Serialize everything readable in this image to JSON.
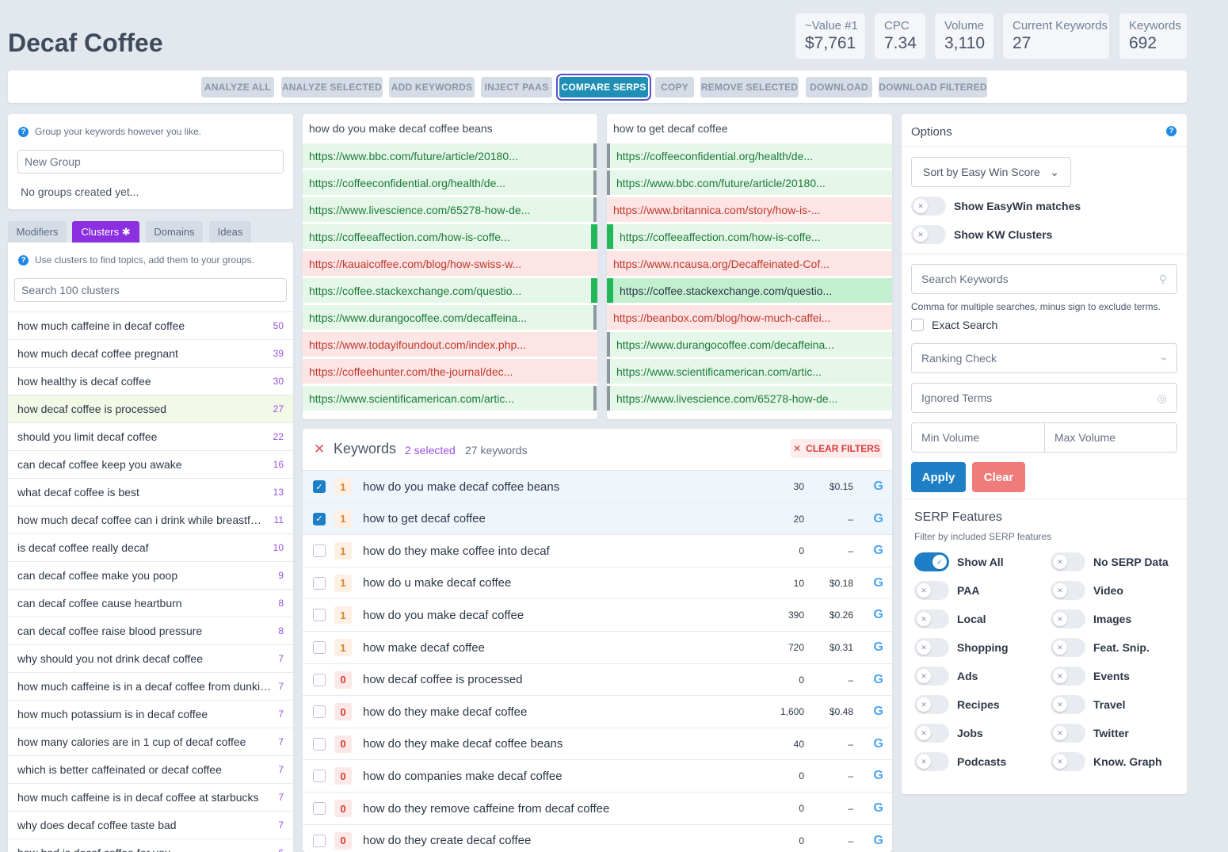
{
  "title": "Decaf Coffee",
  "stats": [
    {
      "label": "~Value #1",
      "value": "$7,761"
    },
    {
      "label": "CPC",
      "value": "7.34"
    },
    {
      "label": "Volume",
      "value": "3,110"
    },
    {
      "label": "Current Keywords",
      "value": "27"
    },
    {
      "label": "Keywords",
      "value": "692"
    }
  ],
  "toolbar": {
    "analyze_all": "ANALYZE ALL",
    "analyze_selected": "ANALYZE SELECTED",
    "add_keywords": "ADD KEYWORDS",
    "inject_paas": "INJECT PAAS",
    "compare_serps": "COMPARE SERPS",
    "copy": "COPY",
    "remove_selected": "REMOVE SELECTED",
    "download": "DOWNLOAD",
    "download_filtered": "DOWNLOAD FILTERED"
  },
  "groups": {
    "hint": "Group your keywords however you like.",
    "input_placeholder": "New Group",
    "empty_text": "No groups created yet..."
  },
  "tabs": {
    "modifiers": "Modifiers",
    "clusters": "Clusters",
    "clusters_badge": "✱",
    "domains": "Domains",
    "ideas": "Ideas"
  },
  "clusters": {
    "hint": "Use clusters to find topics, add them to your groups.",
    "search_placeholder": "Search 100 clusters",
    "items": [
      {
        "label": "how much caffeine in decaf coffee",
        "count": "50"
      },
      {
        "label": "how much decaf coffee pregnant",
        "count": "39"
      },
      {
        "label": "how healthy is decaf coffee",
        "count": "30"
      },
      {
        "label": "how decaf coffee is processed",
        "count": "27"
      },
      {
        "label": "should you limit decaf coffee",
        "count": "22"
      },
      {
        "label": "can decaf coffee keep you awake",
        "count": "16"
      },
      {
        "label": "what decaf coffee is best",
        "count": "13"
      },
      {
        "label": "how much decaf coffee can i drink while breastfeeding",
        "count": "11"
      },
      {
        "label": "is decaf coffee really decaf",
        "count": "10"
      },
      {
        "label": "can decaf coffee make you poop",
        "count": "9"
      },
      {
        "label": "can decaf coffee cause heartburn",
        "count": "8"
      },
      {
        "label": "can decaf coffee raise blood pressure",
        "count": "8"
      },
      {
        "label": "why should you not drink decaf coffee",
        "count": "7"
      },
      {
        "label": "how much caffeine is in a decaf coffee from dunkin donuts",
        "count": "7"
      },
      {
        "label": "how much potassium is in decaf coffee",
        "count": "7"
      },
      {
        "label": "how many calories are in 1 cup of decaf coffee",
        "count": "7"
      },
      {
        "label": "which is better caffeinated or decaf coffee",
        "count": "7"
      },
      {
        "label": "how much caffeine is in decaf coffee at starbucks",
        "count": "7"
      },
      {
        "label": "why does decaf coffee taste bad",
        "count": "7"
      },
      {
        "label": "how bad is decaf coffee for you",
        "count": "6"
      }
    ]
  },
  "serp_left": {
    "query": "how do you make decaf coffee beans",
    "rows": [
      {
        "url": "https://www.bbc.com/future/article/20180...",
        "status": "g",
        "marker": "grey"
      },
      {
        "url": "https://coffeeconfidential.org/health/de...",
        "status": "g",
        "marker": "grey"
      },
      {
        "url": "https://www.livescience.com/65278-how-de...",
        "status": "g",
        "marker": "grey"
      },
      {
        "url": "https://coffeeaffection.com/how-is-coffe...",
        "status": "g",
        "marker": "green"
      },
      {
        "url": "https://kauaicoffee.com/blog/how-swiss-w...",
        "status": "r",
        "marker": "none"
      },
      {
        "url": "https://coffee.stackexchange.com/questio...",
        "status": "g",
        "marker": "green"
      },
      {
        "url": "https://www.durangocoffee.com/decaffeina...",
        "status": "g",
        "marker": "grey"
      },
      {
        "url": "https://www.todayifoundout.com/index.php...",
        "status": "r",
        "marker": "none"
      },
      {
        "url": "https://coffeehunter.com/the-journal/dec...",
        "status": "r",
        "marker": "none"
      },
      {
        "url": "https://www.scientificamerican.com/artic...",
        "status": "g",
        "marker": "grey"
      }
    ]
  },
  "serp_right": {
    "query": "how to get decaf coffee",
    "rows": [
      {
        "url": "https://coffeeconfidential.org/health/de...",
        "status": "g",
        "marker": "grey"
      },
      {
        "url": "https://www.bbc.com/future/article/20180...",
        "status": "g",
        "marker": "grey"
      },
      {
        "url": "https://www.britannica.com/story/how-is-...",
        "status": "r",
        "marker": "none"
      },
      {
        "url": "https://coffeeaffection.com/how-is-coffe...",
        "status": "g",
        "marker": "green"
      },
      {
        "url": "https://www.ncausa.org/Decaffeinated-Cof...",
        "status": "r",
        "marker": "none"
      },
      {
        "url": "https://coffee.stackexchange.com/questio...",
        "status": "bg",
        "marker": "green"
      },
      {
        "url": "https://beanbox.com/blog/how-much-caffei...",
        "status": "r",
        "marker": "none"
      },
      {
        "url": "https://www.durangocoffee.com/decaffeina...",
        "status": "g",
        "marker": "grey"
      },
      {
        "url": "https://www.scientificamerican.com/artic...",
        "status": "g",
        "marker": "grey"
      },
      {
        "url": "https://www.livescience.com/65278-how-de...",
        "status": "g",
        "marker": "grey"
      }
    ]
  },
  "keywords": {
    "title": "Keywords",
    "selected": "2 selected",
    "count": "27 keywords",
    "clear_filters": "CLEAR FILTERS",
    "rows": [
      {
        "checked": true,
        "rank": "1",
        "keyword": "how do you make decaf coffee beans",
        "volume": "30",
        "cpc": "$0.15"
      },
      {
        "checked": true,
        "rank": "1",
        "keyword": "how to get decaf coffee",
        "volume": "20",
        "cpc": "–"
      },
      {
        "checked": false,
        "rank": "1",
        "keyword": "how do they make coffee into decaf",
        "volume": "0",
        "cpc": "–"
      },
      {
        "checked": false,
        "rank": "1",
        "keyword": "how do u make decaf coffee",
        "volume": "10",
        "cpc": "$0.18"
      },
      {
        "checked": false,
        "rank": "1",
        "keyword": "how do you make decaf coffee",
        "volume": "390",
        "cpc": "$0.26"
      },
      {
        "checked": false,
        "rank": "1",
        "keyword": "how make decaf coffee",
        "volume": "720",
        "cpc": "$0.31"
      },
      {
        "checked": false,
        "rank": "0",
        "keyword": "how decaf coffee is processed",
        "volume": "0",
        "cpc": "–"
      },
      {
        "checked": false,
        "rank": "0",
        "keyword": "how do they make decaf coffee",
        "volume": "1,600",
        "cpc": "$0.48"
      },
      {
        "checked": false,
        "rank": "0",
        "keyword": "how do they make decaf coffee beans",
        "volume": "40",
        "cpc": "–"
      },
      {
        "checked": false,
        "rank": "0",
        "keyword": "how do companies make decaf coffee",
        "volume": "0",
        "cpc": "–"
      },
      {
        "checked": false,
        "rank": "0",
        "keyword": "how do they remove caffeine from decaf coffee",
        "volume": "0",
        "cpc": "–"
      },
      {
        "checked": false,
        "rank": "0",
        "keyword": "how do they create decaf coffee",
        "volume": "0",
        "cpc": "–"
      }
    ]
  },
  "options": {
    "title": "Options",
    "sort_label": "Sort by Easy Win Score",
    "show_easywin": "Show EasyWin matches",
    "show_clusters": "Show KW Clusters",
    "search_placeholder": "Search Keywords",
    "search_hint": "Comma for multiple searches, minus sign to exclude terms.",
    "exact_search": "Exact Search",
    "ranking_check_placeholder": "Ranking Check",
    "ignored_terms_placeholder": "Ignored Terms",
    "min_volume_placeholder": "Min Volume",
    "max_volume_placeholder": "Max Volume",
    "apply": "Apply",
    "clear": "Clear",
    "serp_title": "SERP Features",
    "serp_hint": "Filter by included SERP features",
    "features_left": [
      {
        "label": "Show All",
        "on": true
      },
      {
        "label": "PAA",
        "on": false
      },
      {
        "label": "Local",
        "on": false
      },
      {
        "label": "Shopping",
        "on": false
      },
      {
        "label": "Ads",
        "on": false
      },
      {
        "label": "Recipes",
        "on": false
      },
      {
        "label": "Jobs",
        "on": false
      },
      {
        "label": "Podcasts",
        "on": false
      }
    ],
    "features_right": [
      {
        "label": "No SERP Data",
        "on": false
      },
      {
        "label": "Video",
        "on": false
      },
      {
        "label": "Images",
        "on": false
      },
      {
        "label": "Feat. Snip.",
        "on": false
      },
      {
        "label": "Events",
        "on": false
      },
      {
        "label": "Travel",
        "on": false
      },
      {
        "label": "Twitter",
        "on": false
      },
      {
        "label": "Know. Graph",
        "on": false
      }
    ]
  },
  "colors": {
    "accent": "#1e7fc6",
    "compare_active": "#1f8fb5",
    "cluster_tab": "#8b2fe0",
    "clear_button": "#f07b7b",
    "serp_match": "#e4f7e8",
    "serp_miss": "#fde4e5"
  }
}
